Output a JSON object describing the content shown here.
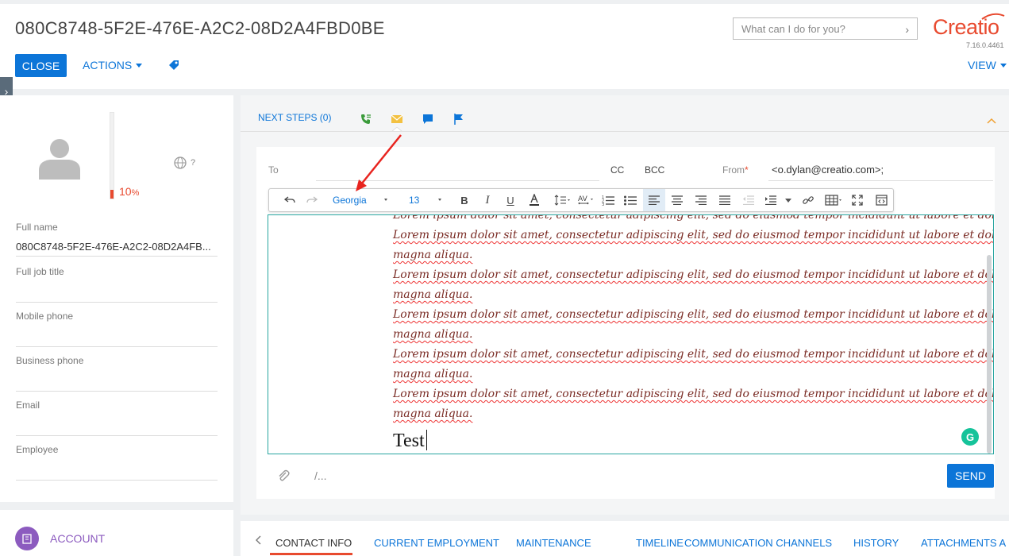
{
  "header": {
    "title": "080C8748-5F2E-476E-A2C2-08D2A4FBD0BE",
    "close_label": "CLOSE",
    "actions_label": "ACTIONS",
    "search_placeholder": "What can I do for you?",
    "logo_text": "Creatio",
    "version": "7.16.0.4461",
    "view_label": "VIEW"
  },
  "profile": {
    "completeness": "10",
    "completeness_unit": "%",
    "completeness_value": 0.1,
    "globe_hint": "?",
    "fields": [
      {
        "label": "Full name",
        "value": "080C8748-5F2E-476E-A2C2-08D2A4FB..."
      },
      {
        "label": "Full job title",
        "value": ""
      },
      {
        "label": "Mobile phone",
        "value": ""
      },
      {
        "label": "Business phone",
        "value": ""
      },
      {
        "label": "Email",
        "value": ""
      },
      {
        "label": "Employee",
        "value": ""
      }
    ]
  },
  "account": {
    "label": "ACCOUNT"
  },
  "next_steps": {
    "label": "NEXT STEPS (0)"
  },
  "email": {
    "to_label": "To",
    "cc_label": "CC",
    "bcc_label": "BCC",
    "from_label": "From",
    "required_mark": "*",
    "from_value": "<o.dylan@creatio.com>;",
    "toolbar": {
      "font": "Georgia",
      "size": "13"
    },
    "body_lines": [
      "Lorem ipsum dolor sit amet, consectetur adipiscing elit, sed do eiusmod tempor incididunt ut labore et dolore",
      "magna aliqua.",
      "Lorem ipsum dolor sit amet, consectetur adipiscing elit, sed do eiusmod tempor incididunt ut labore et dolore",
      "magna aliqua.",
      "Lorem ipsum dolor sit amet, consectetur adipiscing elit, sed do eiusmod tempor incididunt ut labore et dolore",
      "magna aliqua.",
      "Lorem ipsum dolor sit amet, consectetur adipiscing elit, sed do eiusmod tempor incididunt ut labore et dolore",
      "magna aliqua.",
      "Lorem ipsum dolor sit amet, consectetur adipiscing elit, sed do eiusmod tempor incididunt ut labore et dolore",
      "magna aliqua.",
      "Lorem ipsum dolor sit amet, consectetur adipiscing elit, sed do eiusmod tempor incididunt ut labore et dolore",
      "magna aliqua."
    ],
    "typed_text": "Test",
    "grammarly": "G",
    "template_hint": "/...",
    "send_label": "SEND"
  },
  "tabs": [
    {
      "label": "CONTACT INFO"
    },
    {
      "label": "CURRENT EMPLOYMENT"
    },
    {
      "label": "MAINTENANCE"
    },
    {
      "label": "TIMELINE"
    },
    {
      "label": "COMMUNICATION CHANNELS"
    },
    {
      "label": "HISTORY"
    },
    {
      "label": "ATTACHMENTS A"
    }
  ],
  "colors": {
    "accent": "#0c75d8",
    "brand": "#e84a2f",
    "editor_border": "#28a5a0",
    "account": "#8c5bbf"
  }
}
